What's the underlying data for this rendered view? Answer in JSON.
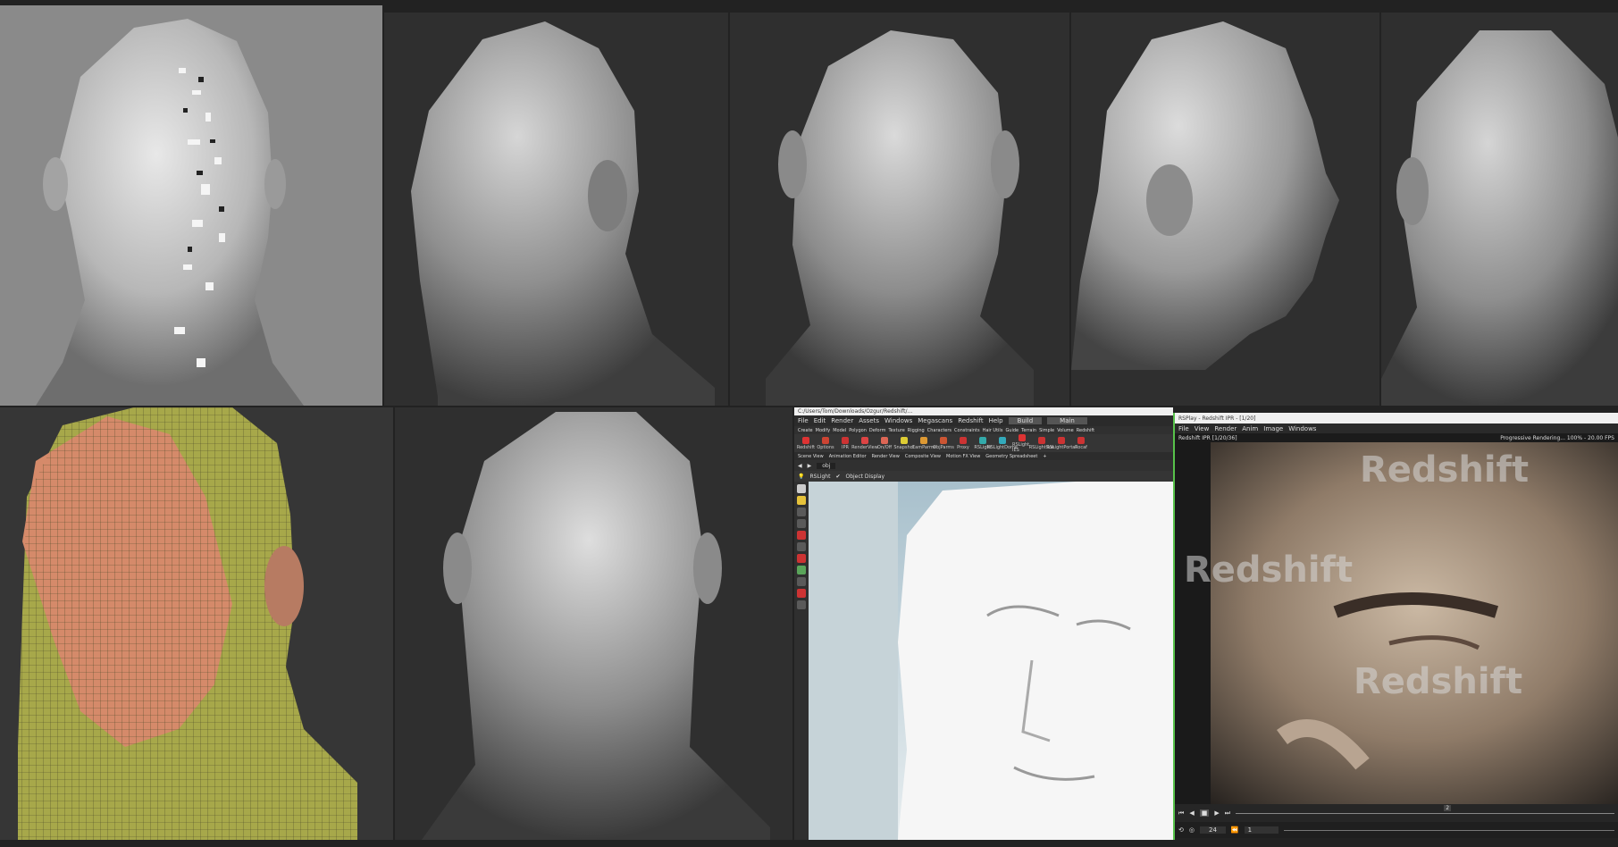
{
  "houdini": {
    "title": "C:/Users/Tom/Downloads/Ozgur/Redshift/...",
    "menu": [
      "File",
      "Edit",
      "Render",
      "Assets",
      "Windows",
      "Megascans",
      "Redshift",
      "Help"
    ],
    "build_label": "Build",
    "main_label": "Main",
    "shelf_tabs": [
      "Create",
      "Modify",
      "Model",
      "Polygon",
      "Deform",
      "Texture",
      "Rigging",
      "Characters",
      "Constraints",
      "Hair Utils",
      "Guide",
      "Terrain",
      "Simple",
      "Volume",
      "Redshift"
    ],
    "shelf_tools": [
      "Redshift",
      "Options",
      "IPR",
      "RenderView",
      "On/Off",
      "Snapshot",
      "CamParms",
      "ObjParms",
      "Proxy",
      "RSLight",
      "RSLightDome",
      "RSLight IES",
      "RSLightSun",
      "RSLightPortal",
      "Rocaf"
    ],
    "pane_tabs": [
      "Scene View",
      "Animation Editor",
      "Render View",
      "Composite View",
      "Motion FX View",
      "Geometry Spreadsheet"
    ],
    "path_label": "obj",
    "viewport_label": "RSLight",
    "object_display": "Object Display"
  },
  "rsview": {
    "title": "RSPlay - Redshift IPR - [1/20]",
    "menu": [
      "File",
      "View",
      "Render",
      "Anim",
      "Image",
      "Windows"
    ],
    "info_left": "Redshift IPR [1/20/36]",
    "info_right": "Progressive Rendering... 100% - 20.00 FPS",
    "watermark": "Redshift",
    "frame_current": "24",
    "frame_start": "1",
    "marker": "2"
  },
  "colors": {
    "zbrush_bg": "#2f2f2f",
    "houdini_bg": "#3a3a3a",
    "accent_green": "#57c24a"
  }
}
